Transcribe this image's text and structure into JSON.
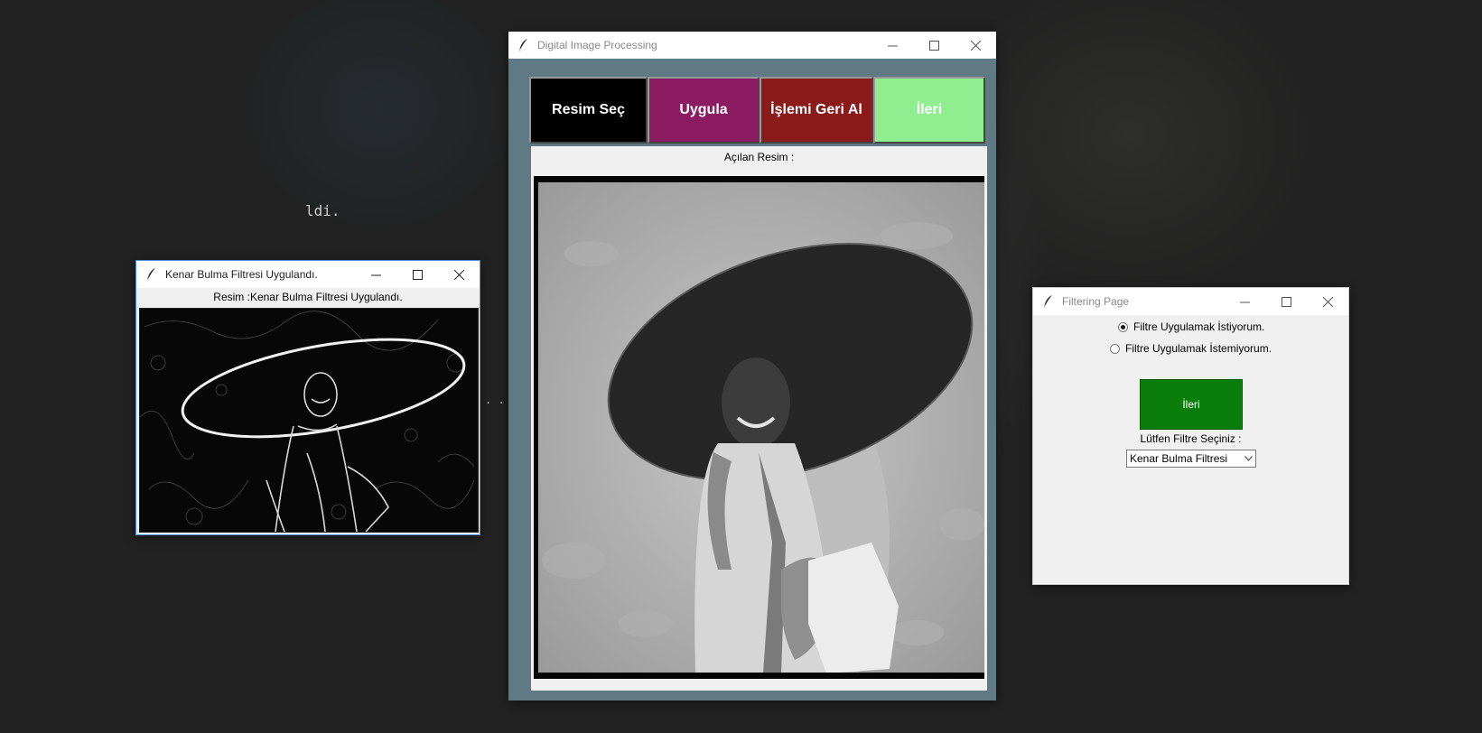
{
  "desktop": {
    "terminal_fragment": "ldi.",
    "dots_left": ". . .",
    "dots_right": "."
  },
  "edge_window": {
    "title": "Kenar Bulma Filtresi Uygulandı.",
    "caption": "Resim :Kenar Bulma Filtresi Uygulandı.",
    "accent": "#4a90e2"
  },
  "main_window": {
    "title": "Digital Image Processing",
    "background": "#5f7a85",
    "buttons": [
      {
        "label": "Resim Seç",
        "color": "#000000"
      },
      {
        "label": "Uygula",
        "color": "#8b1c62"
      },
      {
        "label": "İşlemi Geri Al",
        "color": "#8b1a1a"
      },
      {
        "label": "İleri",
        "color": "#90ee90"
      }
    ],
    "caption": "Açılan Resim :"
  },
  "filter_window": {
    "title": "Filtering Page",
    "radio_options": [
      {
        "label": "Filtre Uygulamak İstiyorum.",
        "checked": true
      },
      {
        "label": "Filtre Uygulamak İstemiyorum.",
        "checked": false
      }
    ],
    "next_button": "İleri",
    "next_color": "#0a7d0a",
    "select_label": "Lütfen Filtre Seçiniz :",
    "select_value": "Kenar Bulma Filtresi"
  },
  "icons": [
    "feather-icon",
    "minimize-icon",
    "maximize-icon",
    "close-icon",
    "chevron-down-icon"
  ]
}
